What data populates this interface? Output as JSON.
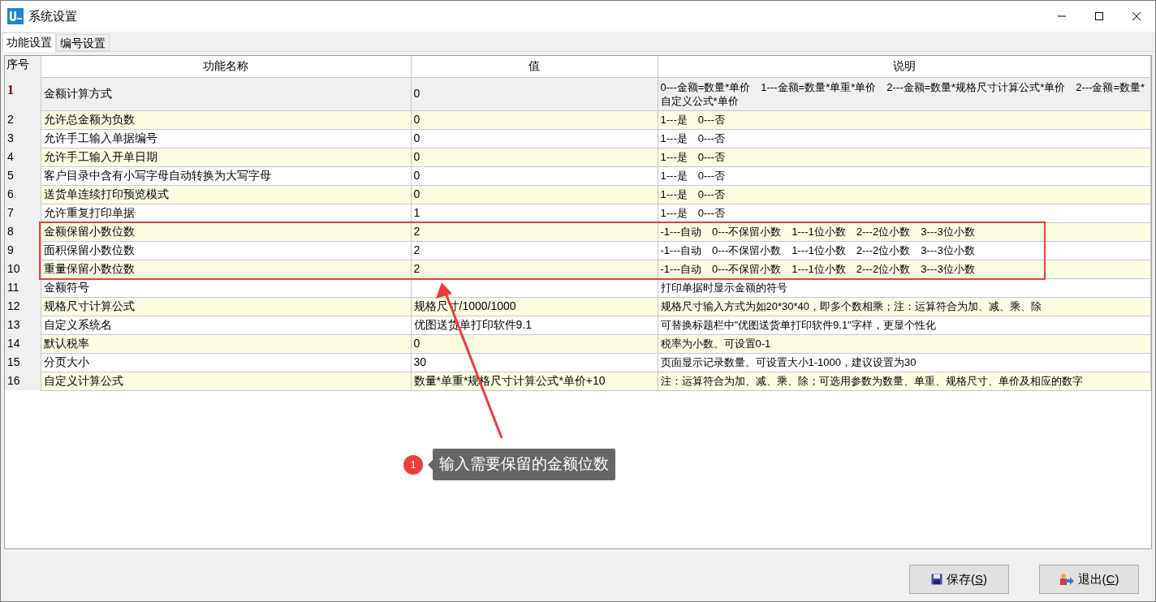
{
  "window": {
    "title": "系统设置"
  },
  "tabs": [
    {
      "label": "功能设置",
      "selected": true
    },
    {
      "label": "编号设置",
      "selected": false
    }
  ],
  "table": {
    "columns": [
      "序号",
      "功能名称",
      "值",
      "说明"
    ],
    "rows": [
      {
        "index": "1",
        "name": "金额计算方式",
        "value": "0",
        "description": "0---金额=数量*单价　1---金额=数量*单重*单价　2---金额=数量*规格尺寸计算公式*单价　2---金额=数量*自定义公式*单价",
        "selected": true
      },
      {
        "index": "2",
        "name": "允许总金额为负数",
        "value": "0",
        "description": "1---是　0---否",
        "selected": false
      },
      {
        "index": "3",
        "name": "允许手工输入单据编号",
        "value": "0",
        "description": "1---是　0---否",
        "selected": false
      },
      {
        "index": "4",
        "name": "允许手工输入开单日期",
        "value": "0",
        "description": "1---是　0---否",
        "selected": false
      },
      {
        "index": "5",
        "name": "客户目录中含有小写字母自动转换为大写字母",
        "value": "0",
        "description": "1---是　0---否",
        "selected": false
      },
      {
        "index": "6",
        "name": "送货单连续打印预览模式",
        "value": "0",
        "description": "1---是　0---否",
        "selected": false
      },
      {
        "index": "7",
        "name": "允许重复打印单据",
        "value": "1",
        "description": "1---是　0---否",
        "selected": false
      },
      {
        "index": "8",
        "name": "金额保留小数位数",
        "value": "2",
        "description": "-1---自动　0---不保留小数　1---1位小数　2---2位小数　3---3位小数",
        "selected": false
      },
      {
        "index": "9",
        "name": "面积保留小数位数",
        "value": "2",
        "description": "-1---自动　0---不保留小数　1---1位小数　2---2位小数　3---3位小数",
        "selected": false
      },
      {
        "index": "10",
        "name": "重量保留小数位数",
        "value": "2",
        "description": "-1---自动　0---不保留小数　1---1位小数　2---2位小数　3---3位小数",
        "selected": false
      },
      {
        "index": "11",
        "name": "金额符号",
        "value": "",
        "description": "打印单据时显示金额的符号",
        "selected": false
      },
      {
        "index": "12",
        "name": "规格尺寸计算公式",
        "value": "规格尺寸/1000/1000",
        "description": "规格尺寸输入方式为如20*30*40，即多个数相乘；注：运算符合为加、减、乘、除",
        "selected": false
      },
      {
        "index": "13",
        "name": "自定义系统名",
        "value": "优图送货单打印软件9.1",
        "description": "可替换标题栏中\"优图送货单打印软件9.1\"字样，更显个性化",
        "selected": false
      },
      {
        "index": "14",
        "name": "默认税率",
        "value": "0",
        "description": "税率为小数。可设置0-1",
        "selected": false
      },
      {
        "index": "15",
        "name": "分页大小",
        "value": "30",
        "description": "页面显示记录数量。可设置大小1-1000，建议设置为30",
        "selected": false
      },
      {
        "index": "16",
        "name": "自定义计算公式",
        "value": "数量*单重*规格尺寸计算公式*单价+10",
        "description": "注：运算符合为加、减、乘、除；可选用参数为数量、单重、规格尺寸、单价及相应的数字",
        "selected": false
      }
    ]
  },
  "annotation": {
    "badge": "1",
    "text": "输入需要保留的金额位数"
  },
  "buttons": [
    {
      "kind": "save",
      "label_parts": [
        "保存(",
        "S",
        ")"
      ]
    },
    {
      "kind": "exit",
      "label_parts": [
        "退出(",
        "C",
        ")"
      ]
    }
  ]
}
